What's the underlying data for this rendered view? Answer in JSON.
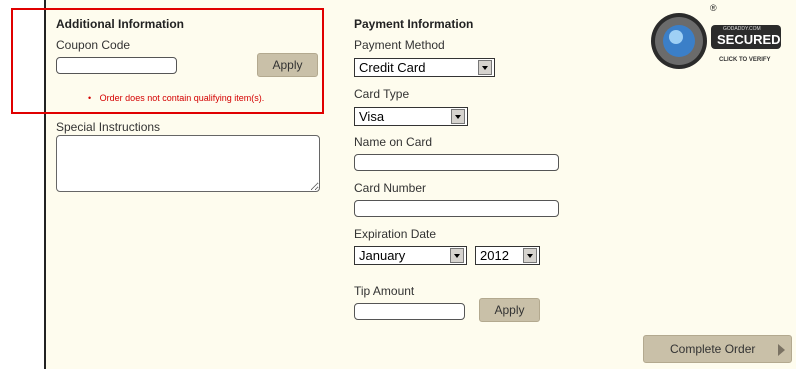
{
  "additional": {
    "heading": "Additional Information",
    "coupon_label": "Coupon Code",
    "coupon_value": "",
    "apply_label": "Apply",
    "error_bullet": "•",
    "error_text": "Order does not contain qualifying item(s).",
    "special_label": "Special Instructions",
    "special_value": ""
  },
  "payment": {
    "heading": "Payment Information",
    "method_label": "Payment Method",
    "method_value": "Credit Card",
    "card_type_label": "Card Type",
    "card_type_value": "Visa",
    "name_label": "Name on Card",
    "name_value": "",
    "number_label": "Card Number",
    "number_value": "",
    "expiration_label": "Expiration Date",
    "exp_month": "January",
    "exp_year": "2012",
    "tip_label": "Tip Amount",
    "tip_value": "",
    "tip_apply_label": "Apply"
  },
  "badge": {
    "registered": "®",
    "brand": "GODADDY.COM",
    "secured": "SECURED",
    "verify": "CLICK TO VERIFY"
  },
  "complete_order_label": "Complete Order",
  "colors": {
    "panel_bg": "#fefcee",
    "button_bg": "#c9c0a8",
    "highlight_red": "#e00000",
    "error_red": "#d40000"
  }
}
